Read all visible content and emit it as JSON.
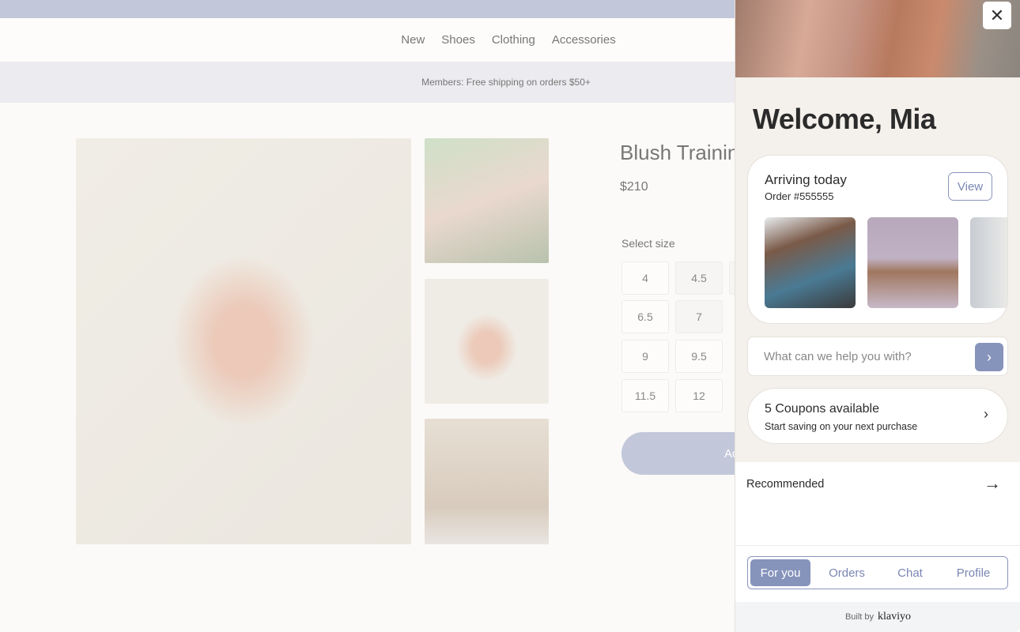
{
  "store": {
    "nav": [
      "New",
      "Shoes",
      "Clothing",
      "Accessories"
    ],
    "banner": "Members: Free shipping on orders $50+",
    "product": {
      "title": "Blush Trainin",
      "price": "$210",
      "size_label": "Select size",
      "sizes": [
        "4",
        "4.5",
        "6.5",
        "7",
        "9",
        "9.5",
        "11.5",
        "12"
      ],
      "add_label": "Ad"
    }
  },
  "panel": {
    "close_icon": "close-icon",
    "welcome": "Welcome, Mia",
    "order": {
      "status": "Arriving today",
      "number": "Order #555555",
      "view_label": "View"
    },
    "chat": {
      "placeholder": "What can we help you with?",
      "send_icon": "chevron-right-icon"
    },
    "coupons": {
      "title": "5 Coupons available",
      "subtitle": "Start saving on your next purchase"
    },
    "recommended": "Recommended",
    "tabs": [
      {
        "label": "For you",
        "active": true
      },
      {
        "label": "Orders"
      },
      {
        "label": "Chat"
      },
      {
        "label": "Profile"
      }
    ],
    "footer": {
      "built_by": "Built by",
      "brand": "klaviyo"
    },
    "accent": "#8693bb"
  }
}
